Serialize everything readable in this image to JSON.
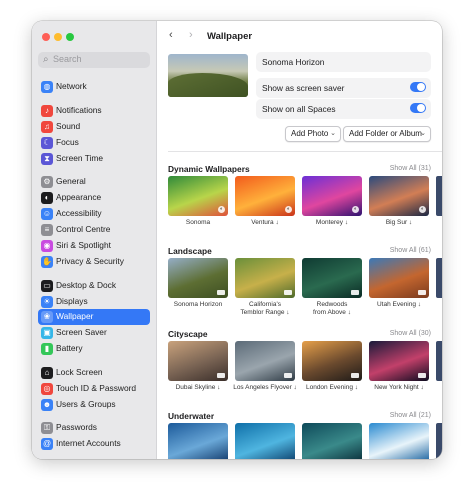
{
  "search": {
    "placeholder": "Search"
  },
  "sidebar": {
    "items": [
      {
        "label": "Network",
        "icon": "globe-icon",
        "color": "#3a82f7"
      },
      {
        "label": "Notifications",
        "icon": "bell-icon",
        "color": "#f0473d"
      },
      {
        "label": "Sound",
        "icon": "speaker-icon",
        "color": "#f0473d"
      },
      {
        "label": "Focus",
        "icon": "moon-icon",
        "color": "#5b56d6"
      },
      {
        "label": "Screen Time",
        "icon": "hourglass-icon",
        "color": "#5b56d6"
      },
      {
        "label": "General",
        "icon": "gear-icon",
        "color": "#8e8e93"
      },
      {
        "label": "Appearance",
        "icon": "appearance-icon",
        "color": "#1c1c1e"
      },
      {
        "label": "Accessibility",
        "icon": "accessibility-icon",
        "color": "#3a82f7"
      },
      {
        "label": "Control Centre",
        "icon": "control-centre-icon",
        "color": "#8e8e93"
      },
      {
        "label": "Siri & Spotlight",
        "icon": "siri-icon",
        "color": "#c94be0"
      },
      {
        "label": "Privacy & Security",
        "icon": "hand-icon",
        "color": "#3a82f7"
      },
      {
        "label": "Desktop & Dock",
        "icon": "dock-icon",
        "color": "#1c1c1e"
      },
      {
        "label": "Displays",
        "icon": "display-icon",
        "color": "#3a82f7"
      },
      {
        "label": "Wallpaper",
        "icon": "wallpaper-icon",
        "color": "#35b6e8"
      },
      {
        "label": "Screen Saver",
        "icon": "screen-saver-icon",
        "color": "#35b6e8"
      },
      {
        "label": "Battery",
        "icon": "battery-icon",
        "color": "#34c759"
      },
      {
        "label": "Lock Screen",
        "icon": "lock-icon",
        "color": "#1c1c1e"
      },
      {
        "label": "Touch ID & Password",
        "icon": "fingerprint-icon",
        "color": "#f0473d"
      },
      {
        "label": "Users & Groups",
        "icon": "users-icon",
        "color": "#3a82f7"
      },
      {
        "label": "Passwords",
        "icon": "key-icon",
        "color": "#8e8e93"
      },
      {
        "label": "Internet Accounts",
        "icon": "at-icon",
        "color": "#3a82f7"
      }
    ],
    "active": "Wallpaper"
  },
  "header": {
    "title": "Wallpaper"
  },
  "current": {
    "name": "Sonoma Horizon",
    "screen_saver_label": "Show as screen saver",
    "screen_saver_on": true,
    "all_spaces_label": "Show on all Spaces",
    "all_spaces_on": true
  },
  "buttons": {
    "add_photo": "Add Photo",
    "add_folder": "Add Folder or Album"
  },
  "sections": [
    {
      "title": "Dynamic Wallpapers",
      "show_all": "Show All (31)",
      "items": [
        {
          "name": "Sonoma",
          "colors": [
            "#2f8a3a",
            "#b8d54a",
            "#e0503a"
          ]
        },
        {
          "name": "Ventura ↓",
          "colors": [
            "#f25b1c",
            "#ffb13b",
            "#c9321a"
          ]
        },
        {
          "name": "Monterey ↓",
          "colors": [
            "#6b2fd6",
            "#e0469f",
            "#2e1270"
          ]
        },
        {
          "name": "Big Sur ↓",
          "colors": [
            "#2b4a7d",
            "#d27e55",
            "#1a2744"
          ]
        }
      ]
    },
    {
      "title": "Landscape",
      "show_all": "Show All (61)",
      "items": [
        {
          "name": "Sonoma Horizon",
          "colors": [
            "#95aec7",
            "#5d6e33",
            "#3d4e22"
          ]
        },
        {
          "name": "California's\nTemblor Range ↓",
          "colors": [
            "#6a8f3a",
            "#c7b04a",
            "#4d6a2b"
          ]
        },
        {
          "name": "Redwoods\nfrom Above ↓",
          "colors": [
            "#0f3a32",
            "#2a6a4f",
            "#0a2a24"
          ]
        },
        {
          "name": "Utah Evening ↓",
          "colors": [
            "#3b79b8",
            "#c4662f",
            "#7a3a1e"
          ]
        }
      ]
    },
    {
      "title": "Cityscape",
      "show_all": "Show All (30)",
      "items": [
        {
          "name": "Dubai Skyline ↓",
          "colors": [
            "#c9a27c",
            "#7a6454",
            "#3a2e2a"
          ]
        },
        {
          "name": "Los Angeles Flyover ↓",
          "colors": [
            "#5c6b78",
            "#9aa5ad",
            "#2e3a44"
          ]
        },
        {
          "name": "London Evening ↓",
          "colors": [
            "#e6a04a",
            "#6b4a2e",
            "#1e1a18"
          ]
        },
        {
          "name": "New York Night ↓",
          "colors": [
            "#1a1a3a",
            "#c2406a",
            "#0a0a1e"
          ]
        }
      ]
    },
    {
      "title": "Underwater",
      "show_all": "Show All (21)",
      "items": [
        {
          "name": "",
          "colors": [
            "#1c5a9a",
            "#6aa8d8",
            "#0e3566"
          ]
        },
        {
          "name": "",
          "colors": [
            "#0f6fa8",
            "#4fb5e0",
            "#0a3a66"
          ]
        },
        {
          "name": "",
          "colors": [
            "#0e4a5a",
            "#3a8a8a",
            "#082a36"
          ]
        },
        {
          "name": "",
          "colors": [
            "#2a8ad0",
            "#e8f4fa",
            "#0e5a9a"
          ]
        }
      ]
    }
  ]
}
